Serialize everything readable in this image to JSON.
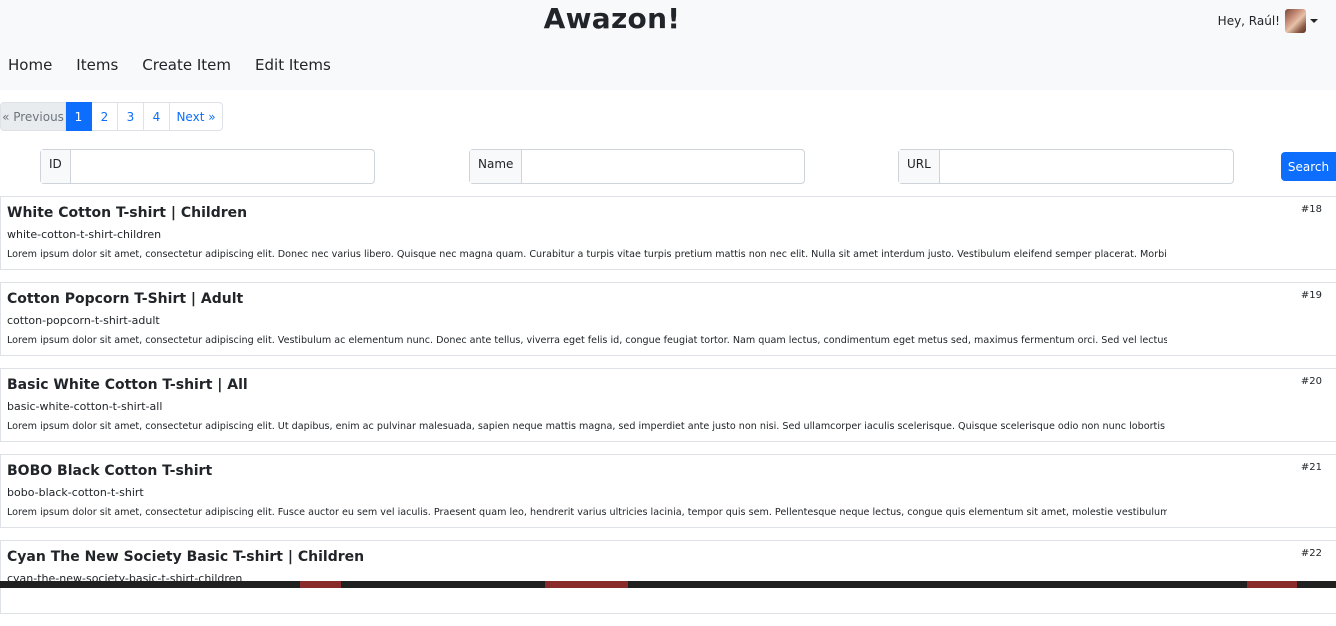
{
  "header": {
    "brand": "Awazon!",
    "greeting": "Hey, Raúl!",
    "nav": [
      "Home",
      "Items",
      "Create Item",
      "Edit Items"
    ]
  },
  "pagination": {
    "previous": "« Previous",
    "pages": [
      "1",
      "2",
      "3",
      "4"
    ],
    "active": "1",
    "next": "Next »"
  },
  "search": {
    "id_label": "ID",
    "id_value": "",
    "name_label": "Name",
    "name_value": "",
    "url_label": "URL",
    "url_value": "",
    "button": "Search"
  },
  "items": [
    {
      "title": "White Cotton T-shirt | Children",
      "slug": "white-cotton-t-shirt-children",
      "desc": "Lorem ipsum dolor sit amet, consectetur adipiscing elit. Donec nec varius libero. Quisque nec magna quam. Curabitur a turpis vitae turpis pretium mattis non nec elit. Nulla sit amet interdum justo. Vestibulum eleifend semper placerat. Morbi tristique...",
      "num": "#18"
    },
    {
      "title": "Cotton Popcorn T-Shirt | Adult",
      "slug": "cotton-popcorn-t-shirt-adult",
      "desc": "Lorem ipsum dolor sit amet, consectetur adipiscing elit. Vestibulum ac elementum nunc. Donec ante tellus, viverra eget felis id, congue feugiat tortor. Nam quam lectus, condimentum eget metus sed, maximus fermentum orci. Sed vel lectus a leo fringill...",
      "num": "#19"
    },
    {
      "title": "Basic White Cotton T-shirt | All",
      "slug": "basic-white-cotton-t-shirt-all",
      "desc": "Lorem ipsum dolor sit amet, consectetur adipiscing elit. Ut dapibus, enim ac pulvinar malesuada, sapien neque mattis magna, sed imperdiet ante justo non nisi. Sed ullamcorper iaculis scelerisque. Quisque scelerisque odio non nunc lobortis sollicitudi...",
      "num": "#20"
    },
    {
      "title": "BOBO Black Cotton T-shirt",
      "slug": "bobo-black-cotton-t-shirt",
      "desc": "Lorem ipsum dolor sit amet, consectetur adipiscing elit. Fusce auctor eu sem vel iaculis. Praesent quam leo, hendrerit varius ultricies lacinia, tempor quis sem. Pellentesque neque lectus, congue quis elementum sit amet, molestie vestibulum sapien. A...",
      "num": "#21"
    },
    {
      "title": "Cyan The New Society Basic T-shirt | Children",
      "slug": "cyan-the-new-society-basic-t-shirt-children",
      "desc": "",
      "num": "#22"
    }
  ],
  "colors": {
    "primary": "#0d6efd",
    "header_bg": "#f8f9fa",
    "border": "#dee2e6",
    "taskbar": "#202020",
    "taskbar_accent": "#8a2b2b"
  }
}
